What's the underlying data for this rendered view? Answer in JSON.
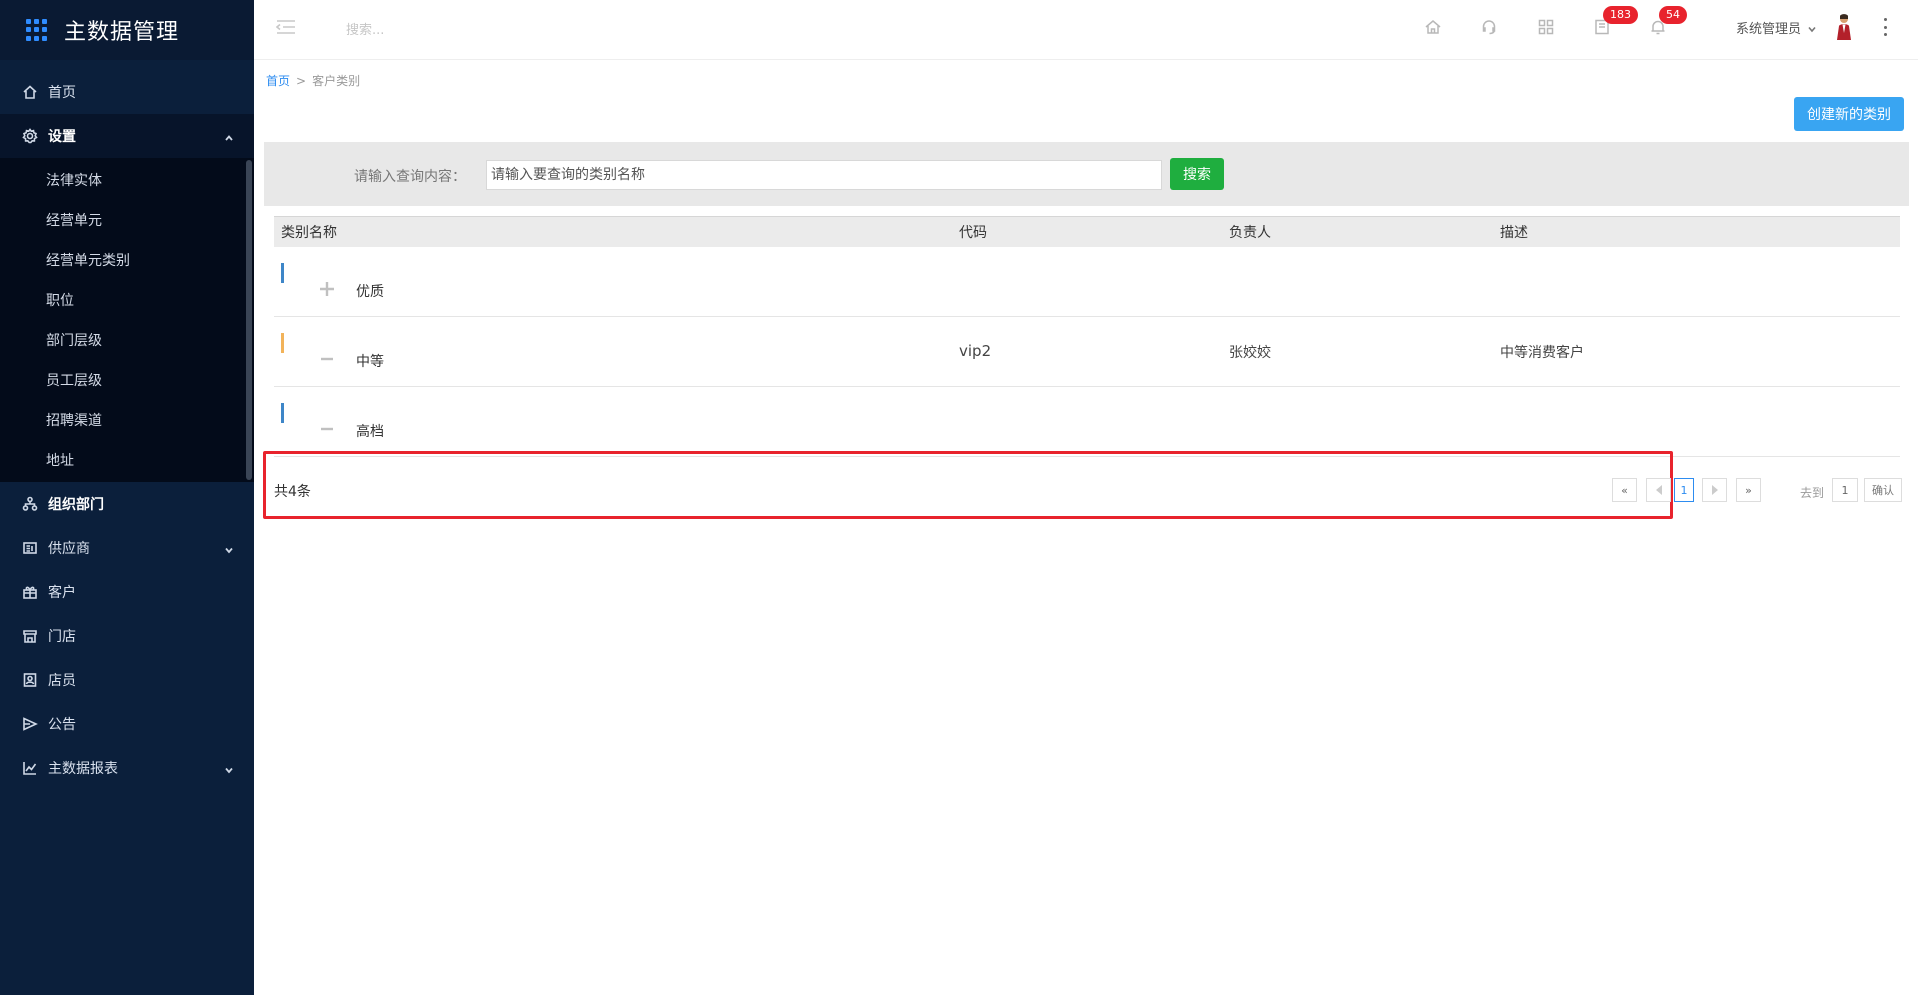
{
  "app": {
    "title": "主数据管理"
  },
  "sidebar": {
    "items": [
      {
        "label": "首页",
        "icon": "home-icon"
      },
      {
        "label": "设置",
        "icon": "gear-icon",
        "expanded": true
      },
      {
        "label": "组织部门",
        "icon": "org-icon"
      },
      {
        "label": "供应商",
        "icon": "supplier-icon",
        "expandable": true
      },
      {
        "label": "客户",
        "icon": "customer-icon"
      },
      {
        "label": "门店",
        "icon": "store-icon"
      },
      {
        "label": "店员",
        "icon": "clerk-icon"
      },
      {
        "label": "公告",
        "icon": "announce-icon"
      },
      {
        "label": "主数据报表",
        "icon": "chart-icon",
        "expandable": true
      }
    ],
    "settings_submenu": [
      "法律实体",
      "经营单元",
      "经营单元类别",
      "职位",
      "部门层级",
      "员工层级",
      "招聘渠道",
      "地址"
    ]
  },
  "topbar": {
    "search_placeholder": "搜索...",
    "messages_badge": "183",
    "notifications_badge": "54",
    "user_name": "系统管理员"
  },
  "breadcrumb": {
    "home": "首页",
    "separator": ">",
    "current": "客户类别"
  },
  "actions": {
    "create_label": "创建新的类别"
  },
  "filter": {
    "label": "请输入查询内容：",
    "placeholder": "请输入要查询的类别名称",
    "search_label": "搜索"
  },
  "table": {
    "columns": [
      "类别名称",
      "代码",
      "负责人",
      "描述"
    ],
    "rows": [
      {
        "name": "优质",
        "code": "",
        "owner": "",
        "desc": "",
        "toggle": "plus",
        "bar_color": "#3e86c8"
      },
      {
        "name": "中等",
        "code": "vip2",
        "owner": "张姣姣",
        "desc": "中等消费客户",
        "toggle": "minus",
        "bar_color": "#f2b35a"
      },
      {
        "name": "高档",
        "code": "",
        "owner": "",
        "desc": "",
        "toggle": "minus",
        "bar_color": "#3e86c8"
      }
    ]
  },
  "footer": {
    "total": "共4条",
    "first": "«",
    "last": "»",
    "current_page": "1",
    "goto_label": "去到",
    "goto_value": "1",
    "confirm_label": "确认"
  },
  "colors": {
    "sidebar_bg": "#0b1f3b",
    "primary": "#39a5f2",
    "search_btn": "#1fae3f",
    "badge": "#e8232d",
    "highlight": "#e8232d"
  }
}
